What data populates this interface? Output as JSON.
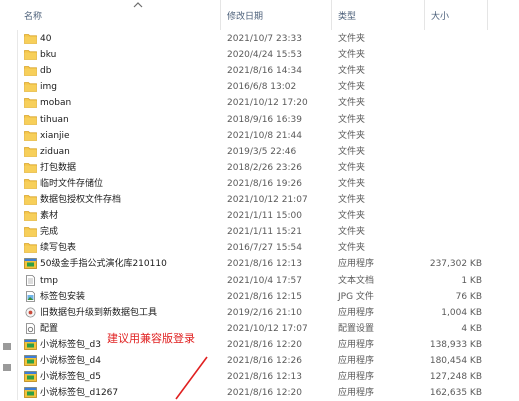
{
  "header": {
    "name": "名称",
    "date": "修改日期",
    "type": "类型",
    "size": "大小"
  },
  "rows": [
    {
      "name": "40",
      "date": "2021/10/7 23:33",
      "type": "文件夹",
      "size": "",
      "icon": "folder-icon"
    },
    {
      "name": "bku",
      "date": "2020/4/24 15:53",
      "type": "文件夹",
      "size": "",
      "icon": "folder-icon"
    },
    {
      "name": "db",
      "date": "2021/8/16 14:34",
      "type": "文件夹",
      "size": "",
      "icon": "folder-icon"
    },
    {
      "name": "img",
      "date": "2016/6/8 13:02",
      "type": "文件夹",
      "size": "",
      "icon": "folder-icon"
    },
    {
      "name": "moban",
      "date": "2021/10/12 17:20",
      "type": "文件夹",
      "size": "",
      "icon": "folder-icon"
    },
    {
      "name": "tihuan",
      "date": "2018/9/16 16:39",
      "type": "文件夹",
      "size": "",
      "icon": "folder-icon"
    },
    {
      "name": "xianjie",
      "date": "2021/10/8 21:44",
      "type": "文件夹",
      "size": "",
      "icon": "folder-icon"
    },
    {
      "name": "ziduan",
      "date": "2019/3/5 22:46",
      "type": "文件夹",
      "size": "",
      "icon": "folder-icon"
    },
    {
      "name": "打包数据",
      "date": "2018/2/26 23:26",
      "type": "文件夹",
      "size": "",
      "icon": "folder-icon"
    },
    {
      "name": "临时文件存储位",
      "date": "2021/8/16 19:26",
      "type": "文件夹",
      "size": "",
      "icon": "folder-icon"
    },
    {
      "name": "数据包授权文件存档",
      "date": "2021/10/12 21:07",
      "type": "文件夹",
      "size": "",
      "icon": "folder-icon"
    },
    {
      "name": "素材",
      "date": "2021/1/11 15:00",
      "type": "文件夹",
      "size": "",
      "icon": "folder-icon"
    },
    {
      "name": "完成",
      "date": "2021/1/11 15:21",
      "type": "文件夹",
      "size": "",
      "icon": "folder-icon"
    },
    {
      "name": "续写包表",
      "date": "2016/7/27 15:54",
      "type": "文件夹",
      "size": "",
      "icon": "folder-icon"
    },
    {
      "name": "50级金手指公式演化库210110",
      "date": "2021/8/16 12:13",
      "type": "应用程序",
      "size": "237,302 KB",
      "icon": "app-icon"
    },
    {
      "name": "tmp",
      "date": "2021/10/4 17:57",
      "type": "文本文档",
      "size": "1 KB",
      "icon": "text-file-icon"
    },
    {
      "name": "标签包安装",
      "date": "2021/8/16 12:15",
      "type": "JPG 文件",
      "size": "76 KB",
      "icon": "image-file-icon"
    },
    {
      "name": "旧数据包升级到新数据包工具",
      "date": "2019/2/16 21:10",
      "type": "应用程序",
      "size": "1,004 KB",
      "icon": "tool-icon"
    },
    {
      "name": "配置",
      "date": "2021/10/12 17:07",
      "type": "配置设置",
      "size": "4 KB",
      "icon": "config-file-icon"
    },
    {
      "name": "小说标签包_d3",
      "date": "2021/8/16 12:20",
      "type": "应用程序",
      "size": "138,933 KB",
      "icon": "app-icon"
    },
    {
      "name": "小说标签包_d4",
      "date": "2021/8/16 12:26",
      "type": "应用程序",
      "size": "180,454 KB",
      "icon": "app-icon"
    },
    {
      "name": "小说标签包_d5",
      "date": "2021/8/16 12:13",
      "type": "应用程序",
      "size": "127,248 KB",
      "icon": "app-icon"
    },
    {
      "name": "小说标签包_d1267",
      "date": "2021/8/16 12:20",
      "type": "应用程序",
      "size": "162,635 KB",
      "icon": "app-icon"
    }
  ],
  "annotation": "建议用兼容版登录",
  "colors": {
    "folder": "#e8b93a",
    "annotation": "#e02020",
    "header_text": "#4c607a"
  }
}
